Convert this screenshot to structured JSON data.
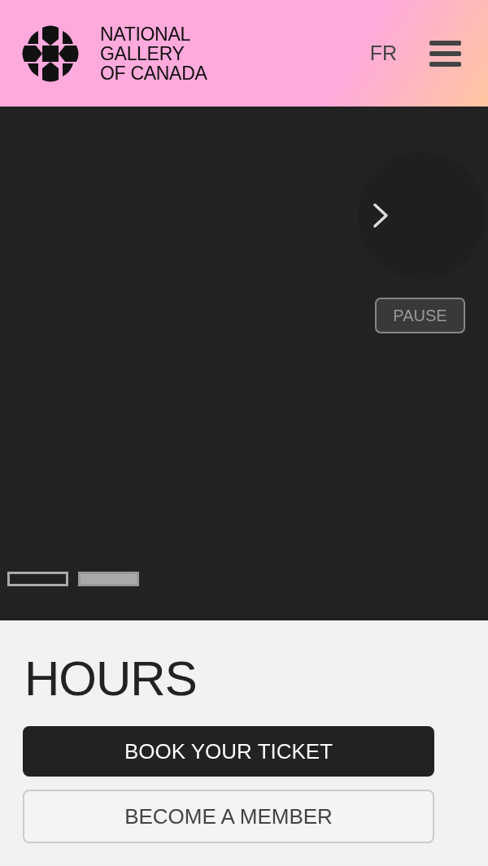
{
  "header": {
    "logo_text": [
      "NATIONAL",
      "GALLERY",
      "OF CANADA"
    ],
    "language": "FR"
  },
  "carousel": {
    "pause_label": "PAUSE",
    "slides": [
      {
        "selected": false
      },
      {
        "selected": true
      }
    ]
  },
  "hours": {
    "title": "HOURS",
    "buttons": [
      {
        "label": "BOOK YOUR TICKET",
        "kind": "primary"
      },
      {
        "label": "BECOME A MEMBER",
        "kind": "secondary"
      }
    ]
  }
}
